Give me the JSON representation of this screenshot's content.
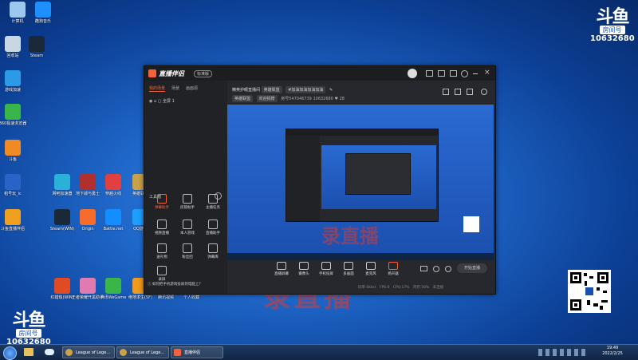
{
  "desktop": {
    "icons": [
      {
        "label": "计算机",
        "color": "#9ec7f0"
      },
      {
        "label": "酷狗音乐",
        "color": "#1e8fff"
      },
      {
        "label": "回收站",
        "color": "#c9d6e3"
      },
      {
        "label": "Steam",
        "color": "#1b2838"
      },
      {
        "label": "游戏加速",
        "color": "#2b9be8"
      },
      {
        "label": "360极速浏览器",
        "color": "#3ab54a"
      },
      {
        "label": "斗鱼",
        "color": "#f08a24"
      },
      {
        "label": "租号玩_ic",
        "color": "#2a63c8"
      },
      {
        "label": "斗鱼直播伴侣",
        "color": "#f0a020"
      },
      {
        "label": "网吧加速器",
        "color": "#2bb0d8"
      },
      {
        "label": "地下城与勇士",
        "color": "#b03030"
      },
      {
        "label": "穿越火线",
        "color": "#e04040"
      },
      {
        "label": "英雄联盟",
        "color": "#c9a34a"
      },
      {
        "label": "Steam(WIN)",
        "color": "#1b2838"
      },
      {
        "label": "Origin",
        "color": "#f56c2d"
      },
      {
        "label": "Battle.net",
        "color": "#148eff"
      },
      {
        "label": "QQ游戏",
        "color": "#1fa0ff"
      },
      {
        "label": "红蜡烛(WIN)",
        "color": "#e04b24"
      },
      {
        "label": "王者荣耀开黑助手",
        "color": "#e07ab0"
      },
      {
        "label": "腾讯WeGame",
        "color": "#39b54a"
      },
      {
        "label": "绝地求生(5F)",
        "color": "#f09a20"
      },
      {
        "label": "腾讯视频",
        "color": "#ff7a1a"
      },
      {
        "label": "个人收藏",
        "color": "#ffffff"
      }
    ],
    "watermark_large": "录直播",
    "watermark_bottom": "录直播"
  },
  "douyu_logo": {
    "mark": "斗鱼",
    "sub": "房间号",
    "room": "10632680"
  },
  "app": {
    "title": "直播伴侣",
    "title_badge": "标准版",
    "left_tabs": [
      "我的场景",
      "场景",
      "画面源"
    ],
    "scene_label": "全屏 1",
    "tools_title": "工具箱",
    "tools": [
      {
        "label": "弹幕助手"
      },
      {
        "label": "房管助手"
      },
      {
        "label": "主播任务"
      },
      {
        "label": "视频直播"
      },
      {
        "label": "本人游戏"
      },
      {
        "label": "直播助手"
      },
      {
        "label": "送礼物"
      },
      {
        "label": "粉丝团"
      },
      {
        "label": "弹幕库"
      },
      {
        "label": "录屏"
      }
    ],
    "bottom_notice": "如何把手机游戏投屏到电脑上？",
    "stream_title": "精英护眼直播间",
    "stream_category": "英雄联盟",
    "stream_tag": "#加油加油加油加油",
    "row2_tags": [
      "英雄联盟",
      "欢迎捐赠"
    ],
    "room_info": "房号547046739",
    "room_id": "10632680",
    "fans": "28",
    "controls": [
      {
        "label": "直播屏幕"
      },
      {
        "label": "摄像头"
      },
      {
        "label": "手机投屏"
      },
      {
        "label": "多画面"
      },
      {
        "label": "麦克风"
      },
      {
        "label": "扬声器"
      }
    ],
    "start_button": "开始直播",
    "status": {
      "rate": "码率:0kb/s",
      "frames": "FPS:0",
      "cpu": "CPU:17%",
      "memory": "内存:50%",
      "connect": "未连接"
    }
  },
  "taskbar": {
    "buttons": [
      "League of Lege...",
      "League of Lege...",
      "直播伴侣"
    ],
    "time": "19:49",
    "date": "2022/2/25"
  },
  "colors": {
    "accent": "#f5623a",
    "panel": "#26282d"
  }
}
